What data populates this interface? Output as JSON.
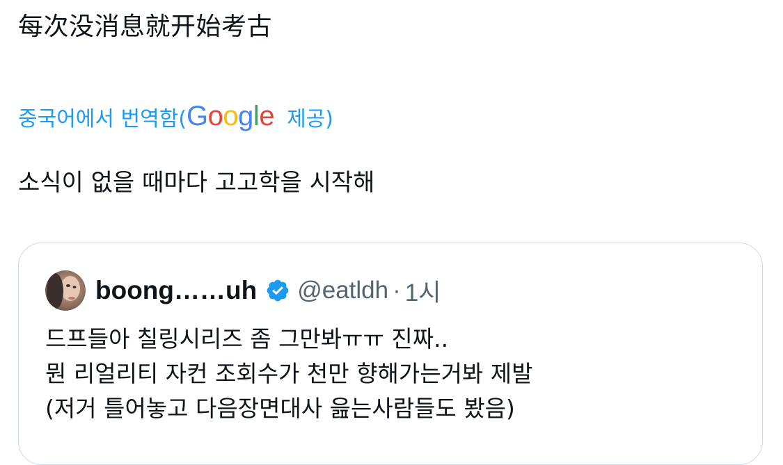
{
  "tweet": {
    "text": "每次没消息就开始考古",
    "translation_prefix": "중국어에서 번역함(",
    "google_letters": [
      "G",
      "o",
      "o",
      "g",
      "l",
      "e"
    ],
    "translation_suffix": "제공)",
    "translated_text": "소식이 없을 때마다 고고학을 시작해"
  },
  "quote": {
    "author_name": "boong……uh",
    "handle": "@eatldh",
    "separator": "·",
    "time": "1시",
    "lines": [
      "드프들아 칠링시리즈 좀 그만봐ㅠㅠ 진짜..",
      "뭔 리얼리티 자컨 조회수가 천만 향해가는거봐 제발",
      "(저거 틀어놓고 다음장면대사 읊는사람들도 봤음)"
    ]
  },
  "colors": {
    "link_blue": "#1d9bf0",
    "text": "#0f1419",
    "secondary": "#536471",
    "border": "#cfd9de",
    "google_blue": "#4285f4",
    "google_red": "#ea4335",
    "google_yellow": "#fbbc05",
    "google_green": "#34a853"
  },
  "icons": {
    "verified": "verified-badge-icon",
    "avatar": "user-avatar"
  }
}
